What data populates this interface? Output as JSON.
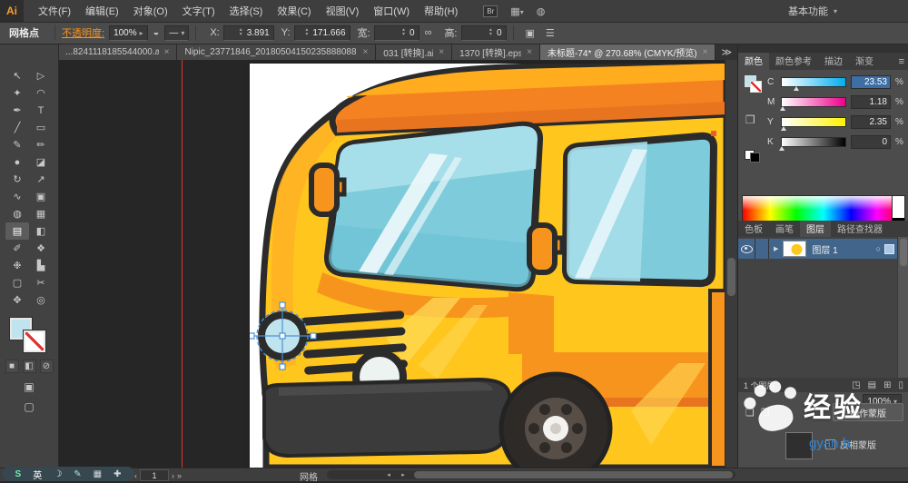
{
  "glyphs": {
    "caret_down": "▾",
    "caret_right": "▸",
    "stepper_up": "▴",
    "stepper_down": "▾",
    "tab_overflow": "≫",
    "tab_close": "×",
    "expander": "▶",
    "target_circle": "○",
    "panel_menu": "≡",
    "cube": "❒",
    "nav_first": "«",
    "nav_prev": "‹",
    "nav_next": "›",
    "nav_last": "»",
    "scroll_left": "◂",
    "scroll_right": "▸"
  },
  "app": {
    "logo_text": "Ai",
    "bridge_label": "Br",
    "workspace_grid_glyph": "▦",
    "arrange_glyph": "◍",
    "workspace_label": "基本功能"
  },
  "menubar": {
    "items": [
      "文件(F)",
      "编辑(E)",
      "对象(O)",
      "文字(T)",
      "选择(S)",
      "效果(C)",
      "视图(V)",
      "窗口(W)",
      "帮助(H)"
    ]
  },
  "controlbar": {
    "context_label": "网格点",
    "opacity_label": "不透明度:",
    "opacity_value": "100%",
    "icons": {
      "recolor": "◒",
      "profile": "—",
      "link": "∞",
      "transform": "▣",
      "align": "☰"
    },
    "x_label": "X:",
    "x_value": "3.891",
    "y_label": "Y:",
    "y_value": "171.666",
    "w_label": "宽:",
    "w_value": "0",
    "h_label": "高:",
    "h_value": "0"
  },
  "tabbar": {
    "tabs": [
      {
        "label": "...8241118185544000.ai*",
        "active": false
      },
      {
        "label": "Nipic_23771846_20180504150235888088.ai*",
        "active": false
      },
      {
        "label": "031 [转换].ai*",
        "active": false
      },
      {
        "label": "1370 [转换].eps*",
        "active": false
      },
      {
        "label": "未标题-74* @ 270.68% (CMYK/预览)",
        "active": true
      }
    ]
  },
  "toolbar": {
    "tools": [
      {
        "name": "selection-tool",
        "glyph": "↖"
      },
      {
        "name": "direct-selection-tool",
        "glyph": "▷"
      },
      {
        "name": "magic-wand-tool",
        "glyph": "✦"
      },
      {
        "name": "lasso-tool",
        "glyph": "◠"
      },
      {
        "name": "pen-tool",
        "glyph": "✒"
      },
      {
        "name": "type-tool",
        "glyph": "T"
      },
      {
        "name": "line-segment-tool",
        "glyph": "╱"
      },
      {
        "name": "rectangle-tool",
        "glyph": "▭"
      },
      {
        "name": "paintbrush-tool",
        "glyph": "✎"
      },
      {
        "name": "pencil-tool",
        "glyph": "✏"
      },
      {
        "name": "blob-brush-tool",
        "glyph": "●"
      },
      {
        "name": "eraser-tool",
        "glyph": "◪"
      },
      {
        "name": "rotate-tool",
        "glyph": "↻"
      },
      {
        "name": "scale-tool",
        "glyph": "↗"
      },
      {
        "name": "width-tool",
        "glyph": "∿"
      },
      {
        "name": "free-transform-tool",
        "glyph": "▣"
      },
      {
        "name": "shape-builder-tool",
        "glyph": "◍"
      },
      {
        "name": "perspective-grid-tool",
        "glyph": "▦"
      },
      {
        "name": "mesh-tool",
        "glyph": "▤",
        "active": true
      },
      {
        "name": "gradient-tool",
        "glyph": "◧"
      },
      {
        "name": "eyedropper-tool",
        "glyph": "✐"
      },
      {
        "name": "blend-tool",
        "glyph": "❖"
      },
      {
        "name": "symbol-sprayer-tool",
        "glyph": "❉"
      },
      {
        "name": "column-graph-tool",
        "glyph": "▙"
      },
      {
        "name": "artboard-tool",
        "glyph": "▢"
      },
      {
        "name": "slice-tool",
        "glyph": "✂"
      },
      {
        "name": "hand-tool",
        "glyph": "✥"
      },
      {
        "name": "zoom-tool",
        "glyph": "◎"
      }
    ],
    "controls": {
      "color": "■",
      "gradient": "◧",
      "none": "⊘",
      "draw_mode": "▣",
      "screen_mode": "▢"
    }
  },
  "color_panel": {
    "tabs": [
      {
        "label": "颜色",
        "active": true
      },
      {
        "label": "颜色参考",
        "active": false
      },
      {
        "label": "描边",
        "active": false
      },
      {
        "label": "渐变",
        "active": false
      }
    ],
    "channels": [
      {
        "label": "C",
        "value": "23.53",
        "unit": "%",
        "pct": 23.5,
        "css": "c",
        "selected": true
      },
      {
        "label": "M",
        "value": "1.18",
        "unit": "%",
        "pct": 1.2,
        "css": "m",
        "selected": false
      },
      {
        "label": "Y",
        "value": "2.35",
        "unit": "%",
        "pct": 2.4,
        "css": "y",
        "selected": false
      },
      {
        "label": "K",
        "value": "0",
        "unit": "%",
        "pct": 0,
        "css": "k",
        "selected": false
      }
    ]
  },
  "panel_group2": {
    "tabs": [
      {
        "label": "色板",
        "active": false
      },
      {
        "label": "画笔",
        "active": false
      },
      {
        "label": "图层",
        "active": true
      },
      {
        "label": "路径查找器",
        "active": false
      }
    ]
  },
  "layers_panel": {
    "layer_name": "图层 1",
    "footer_count": "1 个图层",
    "footer_icons": [
      {
        "name": "make-clip-mask-icon",
        "glyph": "◳"
      },
      {
        "name": "new-sublayer-icon",
        "glyph": "▤"
      },
      {
        "name": "new-layer-icon",
        "glyph": "⊞"
      },
      {
        "name": "delete-layer-icon",
        "glyph": "▯"
      }
    ]
  },
  "transparency_panel": {
    "opacity_value": "100%",
    "icons": [
      "❏",
      "❐"
    ],
    "make_mask_label": "制作蒙版",
    "invert_mask_label": "反相蒙版"
  },
  "watermark": {
    "brand": "经验",
    "url_fragment": "gyan.b"
  },
  "statusbar": {
    "artboard_nav_value": "1",
    "status_text": "网格",
    "ime_icons": [
      {
        "name": "sogou-logo-icon",
        "glyph": "S",
        "color": "#69F0AE"
      },
      {
        "name": "ime-lang-indicator",
        "glyph": "英",
        "color": "#FFFFFF"
      },
      {
        "name": "moon-icon",
        "glyph": "☽",
        "color": "#FFFFFF"
      },
      {
        "name": "brush-icon",
        "glyph": "✎",
        "color": "#B2DFDB"
      },
      {
        "name": "keyboard-icon",
        "glyph": "▦",
        "color": "#CFD8DC"
      },
      {
        "name": "wrench-icon",
        "glyph": "✚",
        "color": "#CFD8DC"
      }
    ]
  }
}
